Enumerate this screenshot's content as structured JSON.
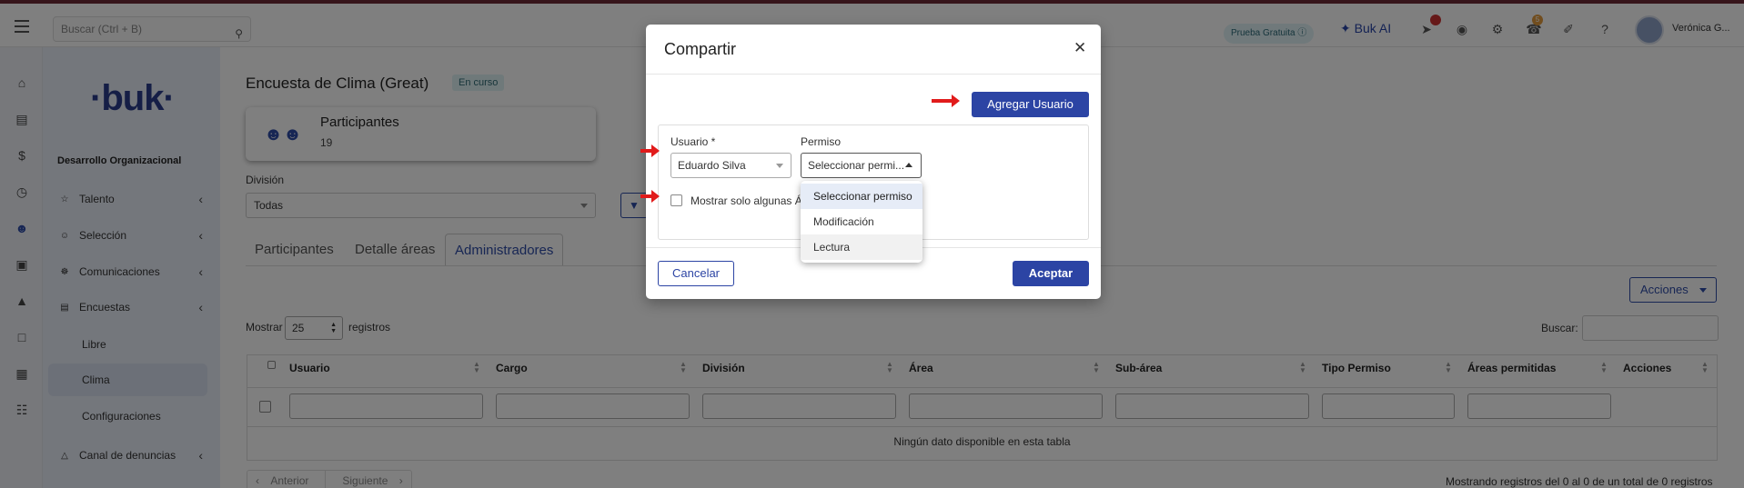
{
  "header": {
    "search_placeholder": "Buscar (Ctrl + B)",
    "trial_label": "Prueba Gratuita",
    "ai_label": "Buk AI",
    "notification_count": "5",
    "user_name": "Verónica G..."
  },
  "sidebar": {
    "logo": "·buk·",
    "section_title": "Desarrollo Organizacional",
    "items": [
      {
        "label": "Talento"
      },
      {
        "label": "Selección"
      },
      {
        "label": "Comunicaciones"
      },
      {
        "label": "Encuestas"
      }
    ],
    "sub_items": [
      {
        "label": "Libre"
      },
      {
        "label": "Clima"
      },
      {
        "label": "Configuraciones"
      }
    ],
    "last_item": {
      "label": "Canal de denuncias"
    }
  },
  "page": {
    "title": "Encuesta de Clima (Great)",
    "status": "En curso",
    "card": {
      "title": "Participantes",
      "value": "19"
    },
    "division_label": "División",
    "division_value": "Todas",
    "tabs": [
      "Participantes",
      "Detalle áreas",
      "Administradores"
    ],
    "actions_label": "Acciones",
    "show_label": "Mostrar",
    "page_size": "25",
    "records_label": "registros",
    "search_label": "Buscar:",
    "columns": [
      "Usuario",
      "Cargo",
      "División",
      "Área",
      "Sub-área",
      "Tipo Permiso",
      "Áreas permitidas",
      "Acciones"
    ],
    "empty_message": "Ningún dato disponible en esta tabla",
    "pager": {
      "prev": "Anterior",
      "next": "Siguiente"
    },
    "showing": "Mostrando registros del 0 al 0 de un total de 0 registros"
  },
  "modal": {
    "title": "Compartir",
    "add_user": "Agregar Usuario",
    "user_label": "Usuario *",
    "user_value": "Eduardo Silva",
    "permission_label": "Permiso",
    "permission_value": "Seleccionar permi...",
    "checkbox_label": "Mostrar solo algunas Á",
    "cancel": "Cancelar",
    "accept": "Aceptar",
    "options": [
      "Seleccionar permiso",
      "Modificación",
      "Lectura"
    ]
  },
  "colors": {
    "primary": "#2c44a4",
    "annotation_arrow": "#e11b1b"
  }
}
